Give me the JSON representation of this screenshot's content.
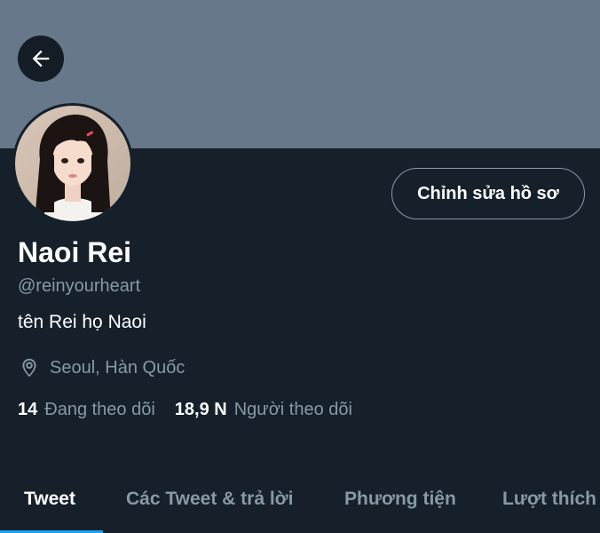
{
  "profile": {
    "name": "Naoi Rei",
    "handle": "@reinyourheart",
    "bio": "tên Rei họ Naoi",
    "location": "Seoul, Hàn Quốc",
    "following_count": "14",
    "following_label": "Đang theo dõi",
    "followers_count": "18,9 N",
    "followers_label": "Người theo dõi"
  },
  "header": {
    "back_icon": "arrow-left-icon",
    "edit_profile_label": "Chỉnh sửa hồ sơ"
  },
  "tabs": [
    {
      "label": "Tweet",
      "active": true
    },
    {
      "label": "Các Tweet & trả lời",
      "active": false
    },
    {
      "label": "Phương tiện",
      "active": false
    },
    {
      "label": "Lượt thích",
      "active": false
    }
  ],
  "colors": {
    "background": "#15202b",
    "banner": "#66788a",
    "text_primary": "#ffffff",
    "text_secondary": "#8899a6",
    "accent": "#1da1f2"
  }
}
